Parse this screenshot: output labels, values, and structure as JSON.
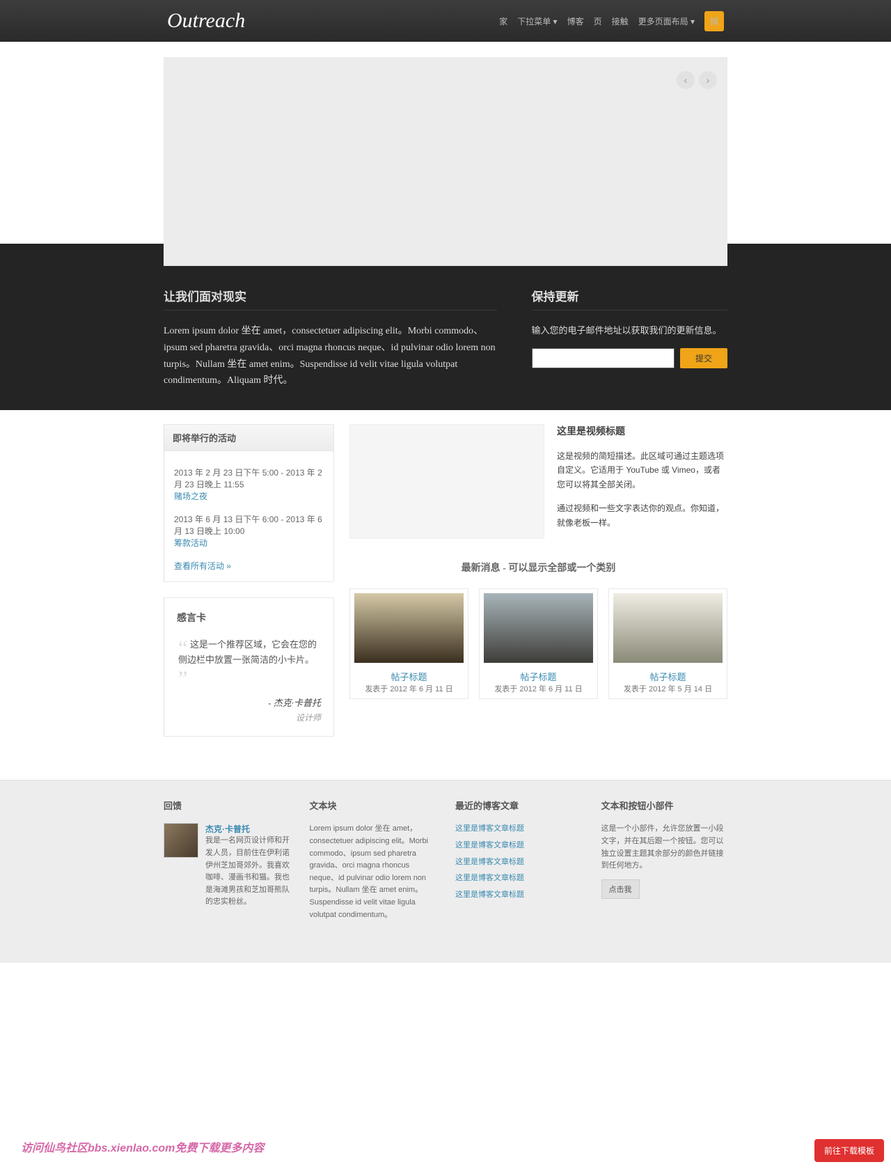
{
  "logo": "Outreach",
  "nav": {
    "home": "家",
    "dropdown": "下拉菜单 ▾",
    "blog": "博客",
    "page": "页",
    "contact": "接触",
    "more": "更多页面布局 ▾",
    "donate": "捐"
  },
  "dark": {
    "left_h": "让我们面对现实",
    "left_p": "Lorem ipsum dolor 坐在 amet，consectetuer adipiscing elit。Morbi commodo、ipsum sed pharetra gravida、orci magna rhoncus neque、id pulvinar odio lorem non turpis。Nullam 坐在 amet enim。Suspendisse id velit vitae ligula volutpat condimentum。Aliquam 时代。",
    "right_h": "保持更新",
    "right_p": "输入您的电子邮件地址以获取我们的更新信息。",
    "submit": "提交"
  },
  "events": {
    "title": "即将举行的活动",
    "e1_time": "2013 年 2 月 23 日下午 5:00 - 2013 年 2 月 23 日晚上 11:55",
    "e1_name": "赌场之夜",
    "e2_time": "2013 年 6 月 13 日下午 6:00 - 2013 年 6 月 13 日晚上 10:00",
    "e2_name": "筹款活动",
    "all": "查看所有活动 »"
  },
  "testimonial": {
    "title": "感言卡",
    "quote": "这是一个推荐区域，它会在您的侧边栏中放置一张简洁的小卡片。",
    "cite": "- 杰克·卡普托",
    "role": "设计师"
  },
  "video": {
    "title": "这里是视频标题",
    "p1": "这是视频的简短描述。此区域可通过主题选项自定义。它适用于 YouTube 或 Vimeo，或者您可以将其全部关闭。",
    "p2": "通过视频和一些文字表达你的观点。你知道，就像老板一样。"
  },
  "news": {
    "heading": "最新消息 - 可以显示全部或一个类别",
    "p1": {
      "title": "帖子标题",
      "date": "发表于 2012 年 6 月 11 日"
    },
    "p2": {
      "title": "帖子标题",
      "date": "发表于 2012 年 6 月 11 日"
    },
    "p3": {
      "title": "帖子标题",
      "date": "发表于 2012 年 5 月 14 日"
    }
  },
  "footer": {
    "c1_h": "回馈",
    "c1_name": "杰克·卡普托",
    "c1_bio": "我是一名网页设计师和开发人员，目前住在伊利诺伊州芝加哥郊外。我喜欢咖啡、漫画书和猫。我也是海滩男孩和芝加哥熊队的忠实粉丝。",
    "c2_h": "文本块",
    "c2_p": "Lorem ipsum dolor 坐在 amet，consectetuer adipiscing elit。Morbi commodo、ipsum sed pharetra gravida、orci magna rhoncus neque、id pulvinar odio lorem non turpis。Nullam 坐在 amet enim。Suspendisse id velit vitae ligula volutpat condimentum。",
    "c3_h": "最近的博客文章",
    "c3_link": "这里是博客文章标题",
    "c4_h": "文本和按钮小部件",
    "c4_p": "这是一个小部件，允许您放置一小段文字，并在其后跟一个按钮。您可以独立设置主题其余部分的颜色并链接到任何地方。",
    "c4_btn": "点击我"
  },
  "download": "前往下载模板",
  "watermark": "访问仙鸟社区bbs.xienlao.com免费下载更多内容"
}
